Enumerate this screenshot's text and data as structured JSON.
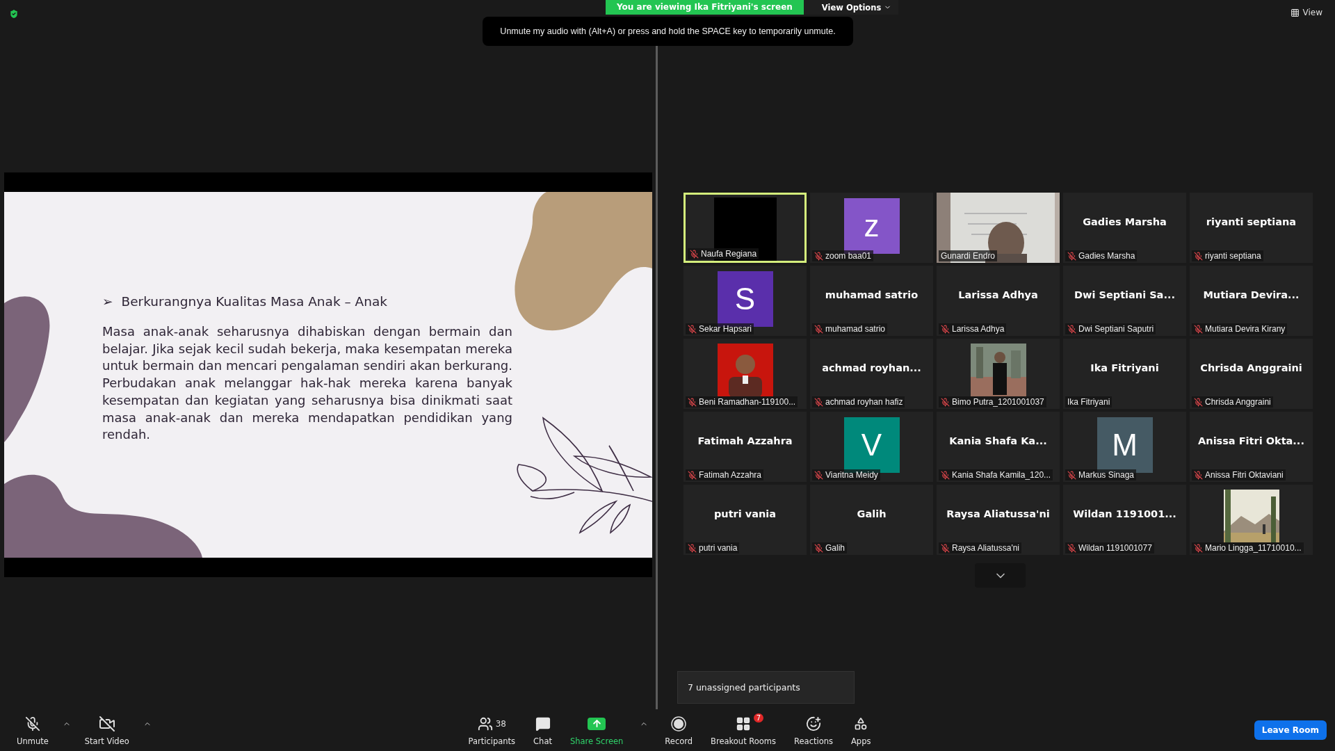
{
  "top_bar": {
    "viewing_banner": "You are viewing Ika Fitriyani's screen",
    "view_options": "View Options",
    "view_button": "View"
  },
  "tooltip": "Unmute my audio with (Alt+A) or press and hold the SPACE key to temporarily unmute.",
  "shared_slide": {
    "heading_marker": "➢",
    "heading": "Berkurangnya Kualitas Masa Anak – Anak",
    "paragraph": "Masa anak-anak seharusnya dihabiskan dengan bermain dan belajar. Jika sejak kecil sudah bekerja, maka kesempatan mereka untuk bermain dan mencari pengalaman sendiri akan berkurang. Perbudakan anak melanggar hak-hak mereka karena banyak kesempatan dan kegiatan yang seharusnya bisa dinikmati saat masa anak-anak dan mereka mendapatkan pendidikan yang rendah."
  },
  "participants": [
    {
      "kind": "dark_video",
      "name": "Naufa Regiana",
      "muted": true,
      "active_speaker": true
    },
    {
      "kind": "avatar",
      "initial": "z",
      "color": "#8455c8",
      "name": "zoom baa01",
      "muted": true,
      "active_speaker": false
    },
    {
      "kind": "video",
      "name": "Gunardi Endro",
      "muted": false,
      "active_speaker": false
    },
    {
      "kind": "name",
      "display_name": "Gadies Marsha",
      "name": "Gadies Marsha",
      "muted": true,
      "active_speaker": false
    },
    {
      "kind": "name",
      "display_name": "riyanti septiana",
      "name": "riyanti septiana",
      "muted": true,
      "active_speaker": false
    },
    {
      "kind": "avatar",
      "initial": "S",
      "color": "#5a2fab",
      "name": "Sekar Hapsari",
      "muted": true,
      "active_speaker": false
    },
    {
      "kind": "name",
      "display_name": "muhamad satrio",
      "name": "muhamad satrio",
      "muted": true,
      "active_speaker": false
    },
    {
      "kind": "name",
      "display_name": "Larissa Adhya",
      "name": "Larissa Adhya",
      "muted": true,
      "active_speaker": false
    },
    {
      "kind": "name",
      "display_name": "Dwi  Septiani  Sa...",
      "name": "Dwi Septiani Saputri",
      "muted": true,
      "active_speaker": false
    },
    {
      "kind": "name",
      "display_name": "Mutiara  Devira...",
      "name": "Mutiara Devira Kirany",
      "muted": true,
      "active_speaker": false
    },
    {
      "name": "Beni Ramadhan-119100...",
      "muted": true,
      "active_speaker": false
    },
    {
      "kind": "name",
      "display_name": "achmad  royhan...",
      "name": "achmad royhan hafiz",
      "muted": true,
      "active_speaker": false
    },
    {
      "name": "Bimo Putra_1201001037",
      "muted": true,
      "active_speaker": false
    },
    {
      "kind": "name",
      "display_name": "Ika Fitriyani",
      "name": "Ika Fitriyani",
      "muted": false,
      "active_speaker": false
    },
    {
      "kind": "name",
      "display_name": "Chrisda Anggraini",
      "name": "Chrisda Anggraini",
      "muted": true,
      "active_speaker": false
    },
    {
      "kind": "name",
      "display_name": "Fatimah Azzahra",
      "name": "Fatimah Azzahra",
      "muted": true,
      "active_speaker": false
    },
    {
      "kind": "avatar",
      "initial": "V",
      "color": "#00897b",
      "name": "Viaritna Meidy",
      "muted": true,
      "active_speaker": false
    },
    {
      "kind": "name",
      "display_name": "Kania  Shafa  Ka...",
      "name": "Kania Shafa Kamila_120...",
      "muted": true,
      "active_speaker": false
    },
    {
      "kind": "avatar",
      "initial": "M",
      "color": "#455a64",
      "name": "Markus Sinaga",
      "muted": true,
      "active_speaker": false
    },
    {
      "kind": "name",
      "display_name": "Anissa  Fitri  Okta...",
      "name": "Anissa Fitri Oktaviani",
      "muted": true,
      "active_speaker": false
    },
    {
      "kind": "name",
      "display_name": "putri vania",
      "name": "putri vania",
      "muted": true,
      "active_speaker": false
    },
    {
      "kind": "name",
      "display_name": "Galih",
      "name": "Galih",
      "muted": true,
      "active_speaker": false
    },
    {
      "kind": "name",
      "display_name": "Raysa Aliatussa'ni",
      "name": "Raysa Aliatussa'ni",
      "muted": true,
      "active_speaker": false
    },
    {
      "kind": "name",
      "display_name": "Wildan  1191001...",
      "name": "Wildan 1191001077",
      "muted": true,
      "active_speaker": false
    },
    {
      "name": "Mario Lingga_11710010...",
      "muted": true,
      "active_speaker": false
    }
  ],
  "unassigned_popup": "7 unassigned participants",
  "toolbar": {
    "left": [
      {
        "kind": "mic",
        "label": "Unmute"
      },
      {
        "kind": "video",
        "label": "Start Video"
      }
    ],
    "center": [
      {
        "kind": "participants",
        "label": "Participants",
        "count": "38"
      },
      {
        "kind": "chat",
        "label": "Chat"
      },
      {
        "kind": "share",
        "label": "Share Screen"
      },
      {
        "kind": "record",
        "label": "Record"
      },
      {
        "kind": "breakout",
        "label": "Breakout Rooms",
        "badge": "7"
      },
      {
        "kind": "reactions",
        "label": "Reactions"
      },
      {
        "kind": "apps",
        "label": "Apps"
      }
    ],
    "leave_button": "Leave Room"
  }
}
